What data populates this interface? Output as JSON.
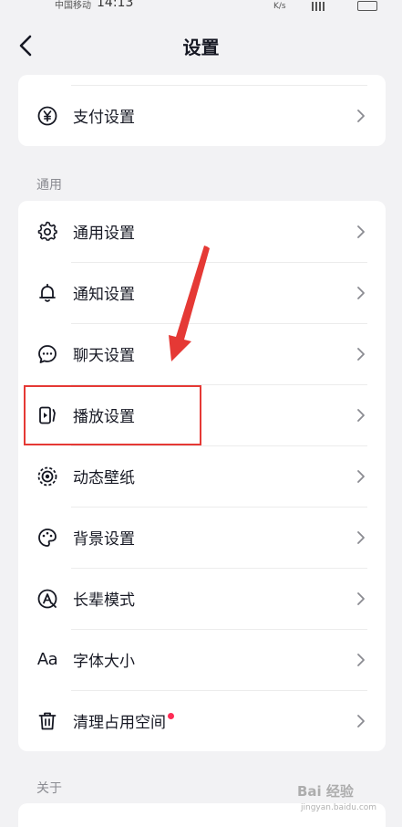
{
  "status_bar": {
    "carrier": "中国移动",
    "time": "14:13",
    "speed": "K/s"
  },
  "header": {
    "title": "设置"
  },
  "top_card": {
    "items": [
      {
        "label": "支付设置",
        "icon": "yen-icon"
      }
    ]
  },
  "sections": {
    "general": {
      "title": "通用",
      "items": [
        {
          "label": "通用设置",
          "icon": "gear-icon"
        },
        {
          "label": "通知设置",
          "icon": "bell-icon"
        },
        {
          "label": "聊天设置",
          "icon": "chat-bubble-icon"
        },
        {
          "label": "播放设置",
          "icon": "play-screen-icon"
        },
        {
          "label": "动态壁纸",
          "icon": "live-wallpaper-icon"
        },
        {
          "label": "背景设置",
          "icon": "palette-icon"
        },
        {
          "label": "长辈模式",
          "icon": "elder-mode-icon"
        },
        {
          "label": "字体大小",
          "icon": "font-size-icon",
          "icon_text": "Aa"
        },
        {
          "label": "清理占用空间",
          "icon": "trash-icon",
          "badge": "red-dot"
        }
      ]
    },
    "about": {
      "title": "关于"
    }
  },
  "watermark": {
    "main": "Bai 经验",
    "sub": "jingyan.baidu.com"
  },
  "colors": {
    "background": "#f2f2f4",
    "card": "#ffffff",
    "text": "#161823",
    "secondary_text": "#8a8b91",
    "annotation_red": "#e53935",
    "badge_red": "#fe2c55"
  }
}
